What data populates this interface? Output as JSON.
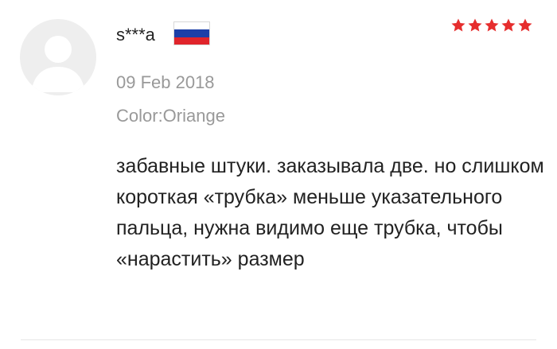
{
  "review": {
    "username": "s***a",
    "country_flag": "russia-flag",
    "rating": 5,
    "rating_max": 5,
    "star_color": "#e62e2e",
    "date": "09 Feb 2018",
    "color_variant": "Color:Oriange",
    "text": "забавные штуки. заказывала две. но слишком короткая «трубка» меньше указательного пальца, нужна видимо еще трубка, чтобы «нарастить» размер"
  },
  "colors": {
    "flag_white": "#ffffff",
    "flag_blue": "#1c3fa8",
    "flag_red": "#e0242b",
    "avatar_bg": "#eeeeee",
    "avatar_fg": "#ffffff"
  }
}
